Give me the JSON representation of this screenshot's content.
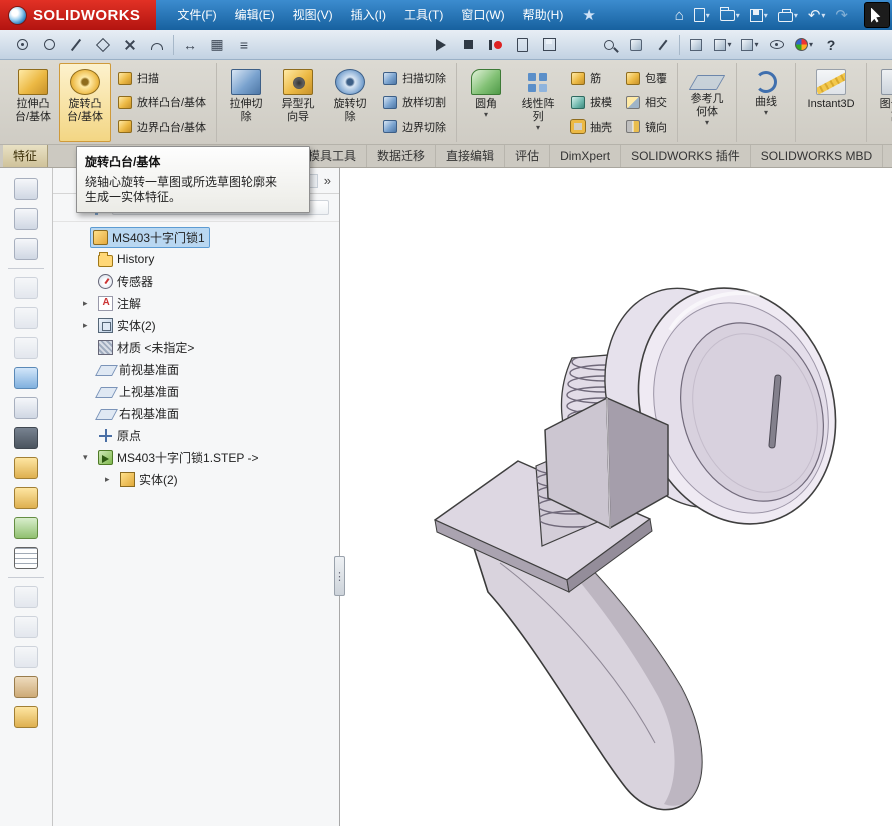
{
  "titlebar": {
    "logo": {
      "name": "SOLIDWORKS"
    },
    "menus": [
      "文件(F)",
      "编辑(E)",
      "视图(V)",
      "插入(I)",
      "工具(T)",
      "窗口(W)",
      "帮助(H)"
    ]
  },
  "ribbon": {
    "extrude_boss": {
      "l1": "拉伸凸",
      "l2": "台/基体"
    },
    "revolve_boss": {
      "l1": "旋转凸",
      "l2": "台/基体"
    },
    "sweep": "扫描",
    "loft": "放样凸台/基体",
    "boundary": "边界凸台/基体",
    "extrude_cut": {
      "l1": "拉伸切",
      "l2": "除"
    },
    "hole_wizard": {
      "l1": "异型孔",
      "l2": "向导"
    },
    "revolve_cut": {
      "l1": "旋转切",
      "l2": "除"
    },
    "sweep_cut": "扫描切除",
    "loft_cut": "放样切割",
    "boundary_cut": "边界切除",
    "fillet": {
      "label": "圆角"
    },
    "linear_pattern": {
      "l1": "线性阵",
      "l2": "列"
    },
    "rib": "筋",
    "draft": "拔模",
    "shell": "抽壳",
    "wrap": "包覆",
    "intersect": "相交",
    "mirror": "镜向",
    "ref_geometry": {
      "l1": "参考几",
      "l2": "何体"
    },
    "curves": {
      "label": "曲线"
    },
    "instant3d": {
      "label": "Instant3D"
    },
    "drawing_split": {
      "l1": "图号分",
      "l2": "离"
    }
  },
  "tabs": {
    "features": "特征",
    "mold_tools": "模具工具",
    "data_migration": "数据迁移",
    "direct_editing": "直接编辑",
    "evaluate": "评估",
    "dimxpert": "DimXpert",
    "solidworks_addins": "SOLIDWORKS 插件",
    "solidworks_mbd": "SOLIDWORKS MBD"
  },
  "tooltip": {
    "title": "旋转凸台/基体",
    "line1": "绕轴心旋转一草图或所选草图轮廓来",
    "line2": "生成一实体特征。"
  },
  "feature_tree": {
    "root": "MS403十字门锁1",
    "history": "History",
    "sensors": "传感器",
    "annotations": "注解",
    "solid_bodies": "实体(2)",
    "material": "材质 <未指定>",
    "front_plane": "前视基准面",
    "top_plane": "上视基准面",
    "right_plane": "右视基准面",
    "origin": "原点",
    "imported_step": "MS403十字门锁1.STEP ->",
    "imported_bodies": "实体(2)",
    "chevron": "»"
  },
  "colors": {
    "titlebar_blue": "#1e6cb5",
    "logo_red": "#d0281e",
    "ribbon_bg": "#d5d2ca",
    "active_tab_tan": "#d9cf9e",
    "hover_gold": "#f3d684",
    "selection_blue": "#b9d7f1",
    "model_lavender": "#d8d2dd"
  }
}
